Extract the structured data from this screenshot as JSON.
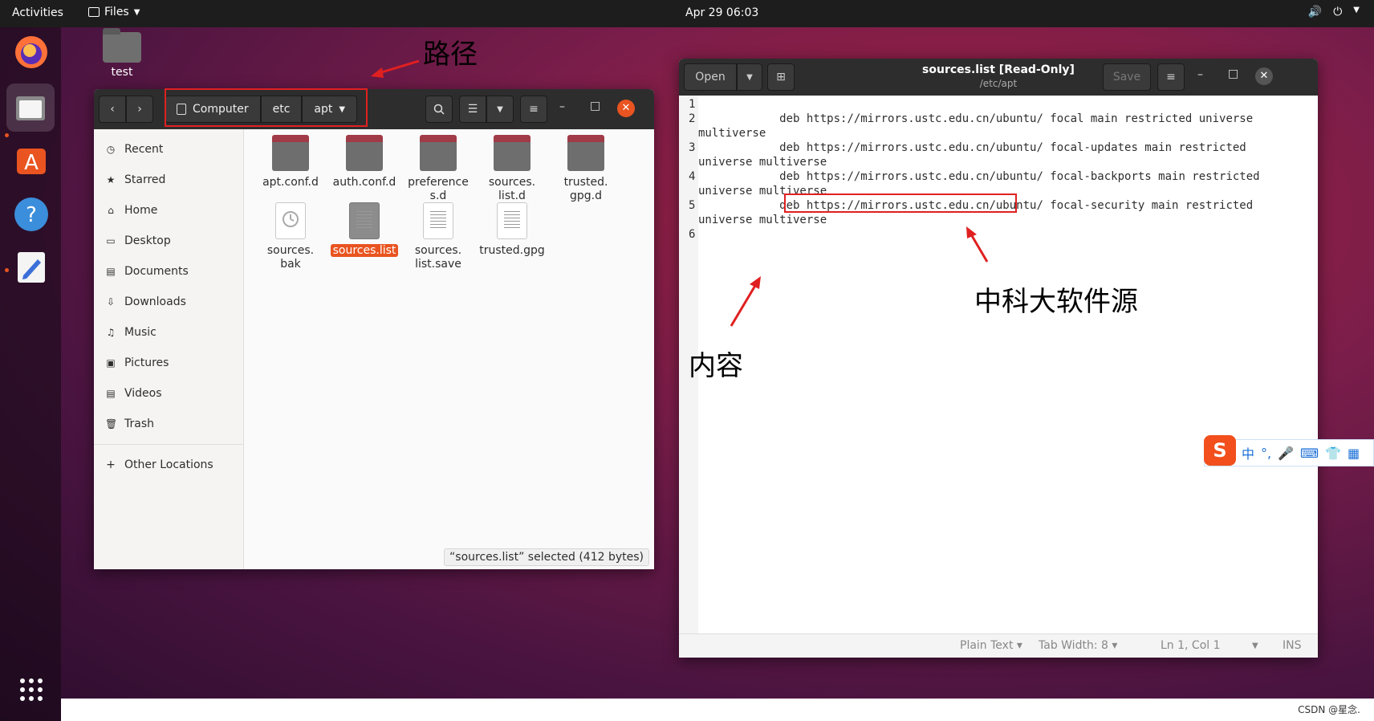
{
  "topbar": {
    "activities": "Activities",
    "files_menu": "Files",
    "clock": "Apr 29  06:03"
  },
  "desktop_icon": {
    "label": "test"
  },
  "files": {
    "pathbar": [
      "Computer",
      "etc",
      "apt"
    ],
    "sidebar": [
      {
        "label": "Recent",
        "icon": "clock-icon"
      },
      {
        "label": "Starred",
        "icon": "star-icon"
      },
      {
        "label": "Home",
        "icon": "home-icon"
      },
      {
        "label": "Desktop",
        "icon": "desktop-icon"
      },
      {
        "label": "Documents",
        "icon": "document-icon"
      },
      {
        "label": "Downloads",
        "icon": "download-icon"
      },
      {
        "label": "Music",
        "icon": "music-icon"
      },
      {
        "label": "Pictures",
        "icon": "picture-icon"
      },
      {
        "label": "Videos",
        "icon": "video-icon"
      },
      {
        "label": "Trash",
        "icon": "trash-icon"
      }
    ],
    "other_locations": "Other Locations",
    "items": [
      {
        "name": "apt.conf.d",
        "type": "folder"
      },
      {
        "name": "auth.conf.d",
        "type": "folder"
      },
      {
        "name": "preference\ns.d",
        "type": "folder"
      },
      {
        "name": "sources.\nlist.d",
        "type": "folder"
      },
      {
        "name": "trusted.\ngpg.d",
        "type": "folder"
      },
      {
        "name": "sources.\nbak",
        "type": "backup"
      },
      {
        "name": "sources.list",
        "type": "file",
        "selected": true
      },
      {
        "name": "sources.\nlist.save",
        "type": "file"
      },
      {
        "name": "trusted.gpg",
        "type": "file"
      }
    ],
    "status": "“sources.list” selected  (412 bytes)"
  },
  "gedit": {
    "open_label": "Open",
    "save_label": "Save",
    "title": "sources.list [Read-Only]",
    "subtitle": "/etc/apt",
    "lines": [
      {
        "n": "1",
        "text": ""
      },
      {
        "n": "2",
        "text": "            deb https://mirrors.ustc.edu.cn/ubuntu/ focal main restricted universe\nmultiverse"
      },
      {
        "n": "3",
        "text": "            deb https://mirrors.ustc.edu.cn/ubuntu/ focal-updates main restricted\nuniverse multiverse"
      },
      {
        "n": "4",
        "text": "            deb https://mirrors.ustc.edu.cn/ubuntu/ focal-backports main restricted\nuniverse multiverse"
      },
      {
        "n": "5",
        "text": "            deb https://mirrors.ustc.edu.cn/ubuntu/ focal-security main restricted\nuniverse multiverse"
      },
      {
        "n": "6",
        "text": ""
      }
    ],
    "status": {
      "language": "Plain Text",
      "tab_width": "Tab Width: 8",
      "position": "Ln 1, Col 1",
      "mode": "INS"
    }
  },
  "annotations": {
    "path": "路径",
    "content": "内容",
    "mirror": "中科大软件源"
  },
  "ime": {
    "logo": "S",
    "mode": "中",
    "punct": "°,"
  },
  "watermark": "CSDN @星念."
}
